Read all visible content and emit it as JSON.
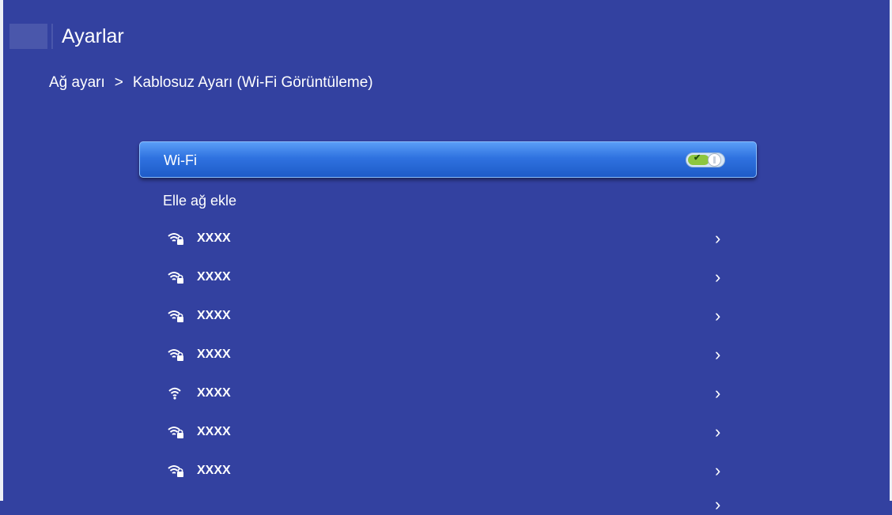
{
  "header": {
    "title": "Ayarlar"
  },
  "breadcrumb": {
    "parent": "Ağ ayarı",
    "separator": ">",
    "current": "Kablosuz Ayarı (Wi-Fi Görüntüleme)"
  },
  "wifi_toggle": {
    "label": "Wi-Fi",
    "state": "on",
    "accent": "#8dc63f"
  },
  "add_network": {
    "label": "Elle ağ ekle"
  },
  "networks": [
    {
      "name": "XXXX",
      "icon": "wifi-lock-icon"
    },
    {
      "name": "XXXX",
      "icon": "wifi-lock-icon"
    },
    {
      "name": "XXXX",
      "icon": "wifi-lock-icon"
    },
    {
      "name": "XXXX",
      "icon": "wifi-lock-icon"
    },
    {
      "name": "XXXX",
      "icon": "wifi-icon"
    },
    {
      "name": "XXXX",
      "icon": "wifi-lock-icon"
    },
    {
      "name": "XXXX",
      "icon": "wifi-lock-icon"
    }
  ],
  "colors": {
    "background": "#3341a0",
    "selected_row": "#2f72e0",
    "text": "#ffffff"
  }
}
